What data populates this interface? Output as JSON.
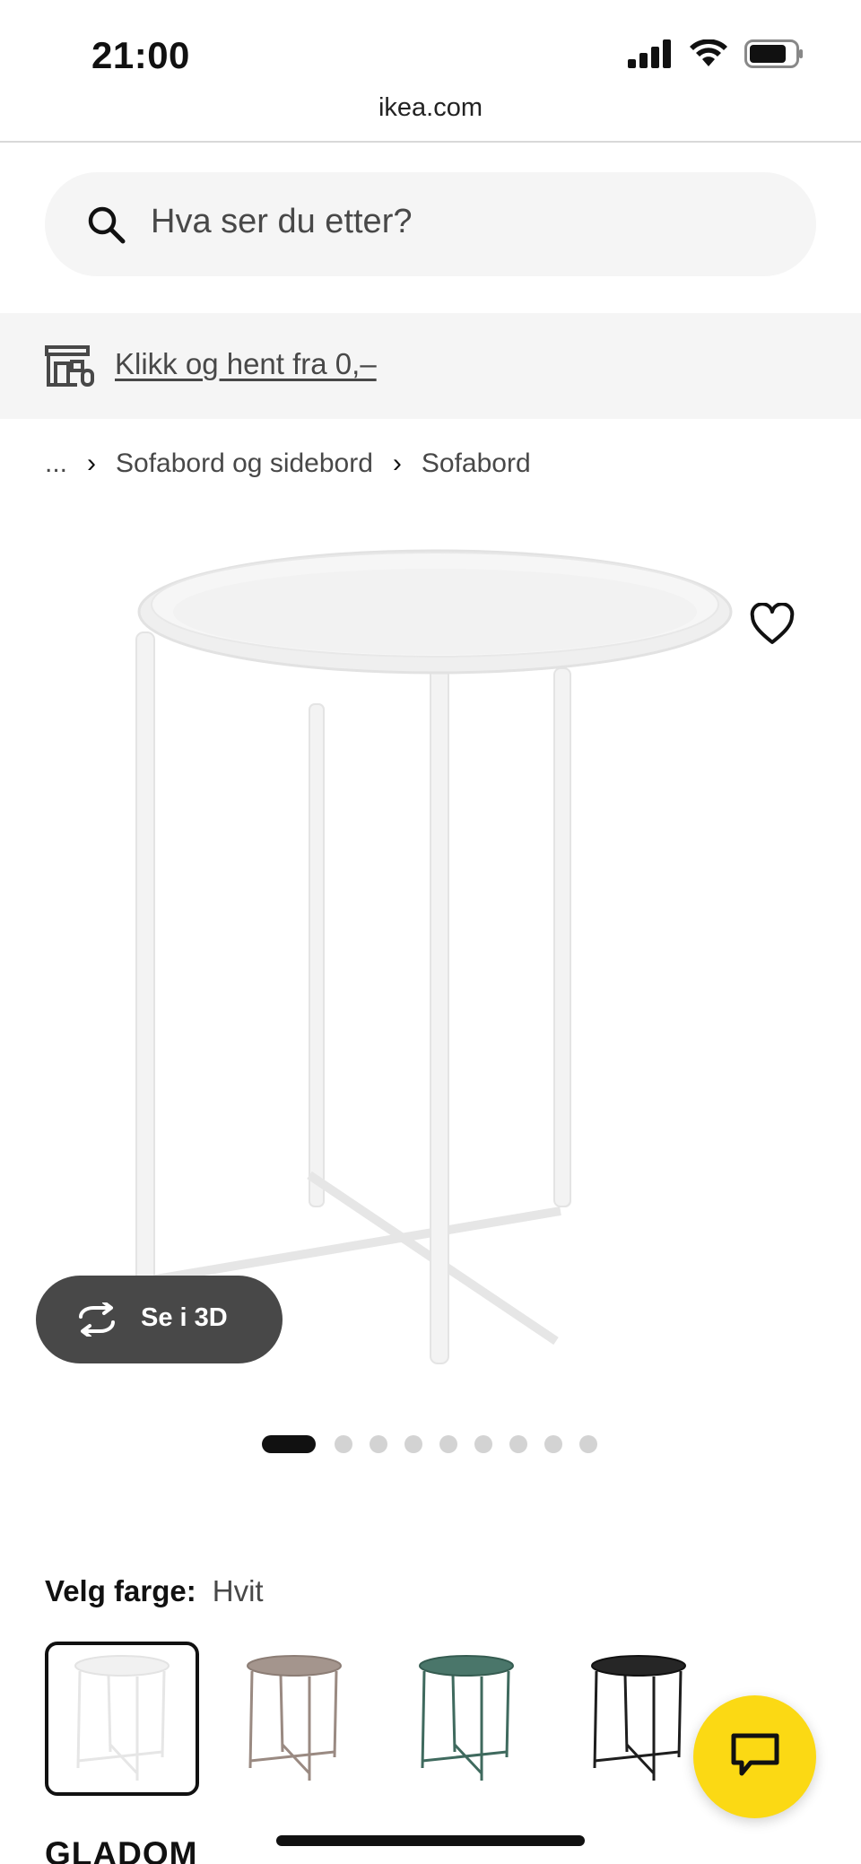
{
  "status_bar": {
    "time": "21:00",
    "icons": [
      "cellular-signal-icon",
      "wifi-icon",
      "battery-icon"
    ]
  },
  "browser": {
    "url": "ikea.com"
  },
  "search": {
    "placeholder": "Hva ser du etter?",
    "icon": "search-icon"
  },
  "promo": {
    "icon": "store-pickup-icon",
    "link_text": "Klikk og hent fra 0,–"
  },
  "breadcrumb": {
    "items": [
      "...",
      "Sofabord og sidebord",
      "Sofabord"
    ]
  },
  "product": {
    "image_alt": "GLADOM brettbord, hvit",
    "favorite_icon": "heart-icon",
    "view_3d_label": "Se i 3D",
    "carousel": {
      "total": 10,
      "active_index": 1
    },
    "color_label": "Velg farge:",
    "color_value": "Hvit",
    "swatches": [
      {
        "name": "Hvit",
        "color": "#f2f2f2",
        "selected": true
      },
      {
        "name": "Beige",
        "color": "#9a8a82",
        "selected": false
      },
      {
        "name": "Mørk grønn",
        "color": "#3f6a5e",
        "selected": false
      },
      {
        "name": "Svart",
        "color": "#1e1e1e",
        "selected": false
      }
    ],
    "name": "GLADOM"
  },
  "chat": {
    "icon": "chat-icon",
    "color": "#fbd914"
  },
  "colors": {
    "text_primary": "#111111",
    "text_secondary": "#484848",
    "surface": "#f5f5f5",
    "pill": "#484848"
  }
}
